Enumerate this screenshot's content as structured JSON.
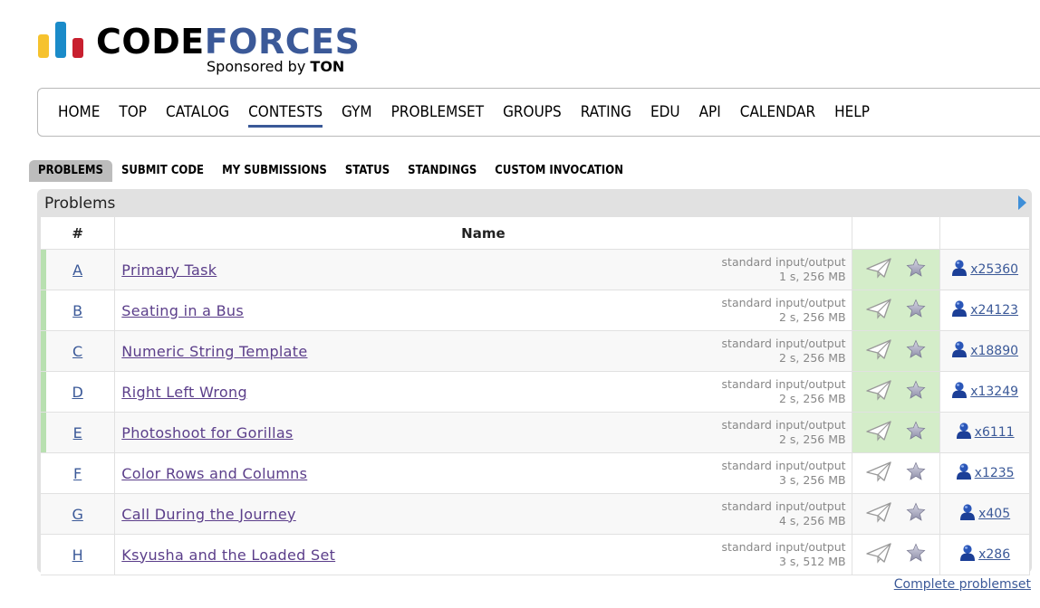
{
  "logo": {
    "brand_part1": "CODE",
    "brand_part2": "FORCES",
    "sponsored": "Sponsored by",
    "sponsor": "TON"
  },
  "menu": {
    "items": [
      "HOME",
      "TOP",
      "CATALOG",
      "CONTESTS",
      "GYM",
      "PROBLEMSET",
      "GROUPS",
      "RATING",
      "EDU",
      "API",
      "CALENDAR",
      "HELP"
    ],
    "active": "CONTESTS"
  },
  "submenu": {
    "items": [
      "PROBLEMS",
      "SUBMIT CODE",
      "MY SUBMISSIONS",
      "STATUS",
      "STANDINGS",
      "CUSTOM INVOCATION"
    ],
    "selected": "PROBLEMS"
  },
  "panel": {
    "title": "Problems",
    "columns": {
      "id": "#",
      "name": "Name"
    }
  },
  "problems": [
    {
      "id": "A",
      "name": "Primary Task",
      "io": "standard input/output",
      "limits": "1 s, 256 MB",
      "count": "x25360",
      "solved": true
    },
    {
      "id": "B",
      "name": "Seating in a Bus",
      "io": "standard input/output",
      "limits": "2 s, 256 MB",
      "count": "x24123",
      "solved": true
    },
    {
      "id": "C",
      "name": "Numeric String Template",
      "io": "standard input/output",
      "limits": "2 s, 256 MB",
      "count": "x18890",
      "solved": true
    },
    {
      "id": "D",
      "name": "Right Left Wrong",
      "io": "standard input/output",
      "limits": "2 s, 256 MB",
      "count": "x13249",
      "solved": true
    },
    {
      "id": "E",
      "name": "Photoshoot for Gorillas",
      "io": "standard input/output",
      "limits": "2 s, 256 MB",
      "count": "x6111",
      "solved": true
    },
    {
      "id": "F",
      "name": "Color Rows and Columns",
      "io": "standard input/output",
      "limits": "3 s, 256 MB",
      "count": "x1235",
      "solved": false
    },
    {
      "id": "G",
      "name": "Call During the Journey",
      "io": "standard input/output",
      "limits": "4 s, 256 MB",
      "count": "x405",
      "solved": false
    },
    {
      "id": "H",
      "name": "Ksyusha and the Loaded Set",
      "io": "standard input/output",
      "limits": "3 s, 512 MB",
      "count": "x286",
      "solved": false
    }
  ],
  "footer": {
    "complete_link": "Complete problemset"
  },
  "colors": {
    "accent": "#3b5998",
    "solved_bar": "#b8e0b0",
    "solved_bg": "#d4edc9",
    "link_visited": "#5b3e8a"
  }
}
